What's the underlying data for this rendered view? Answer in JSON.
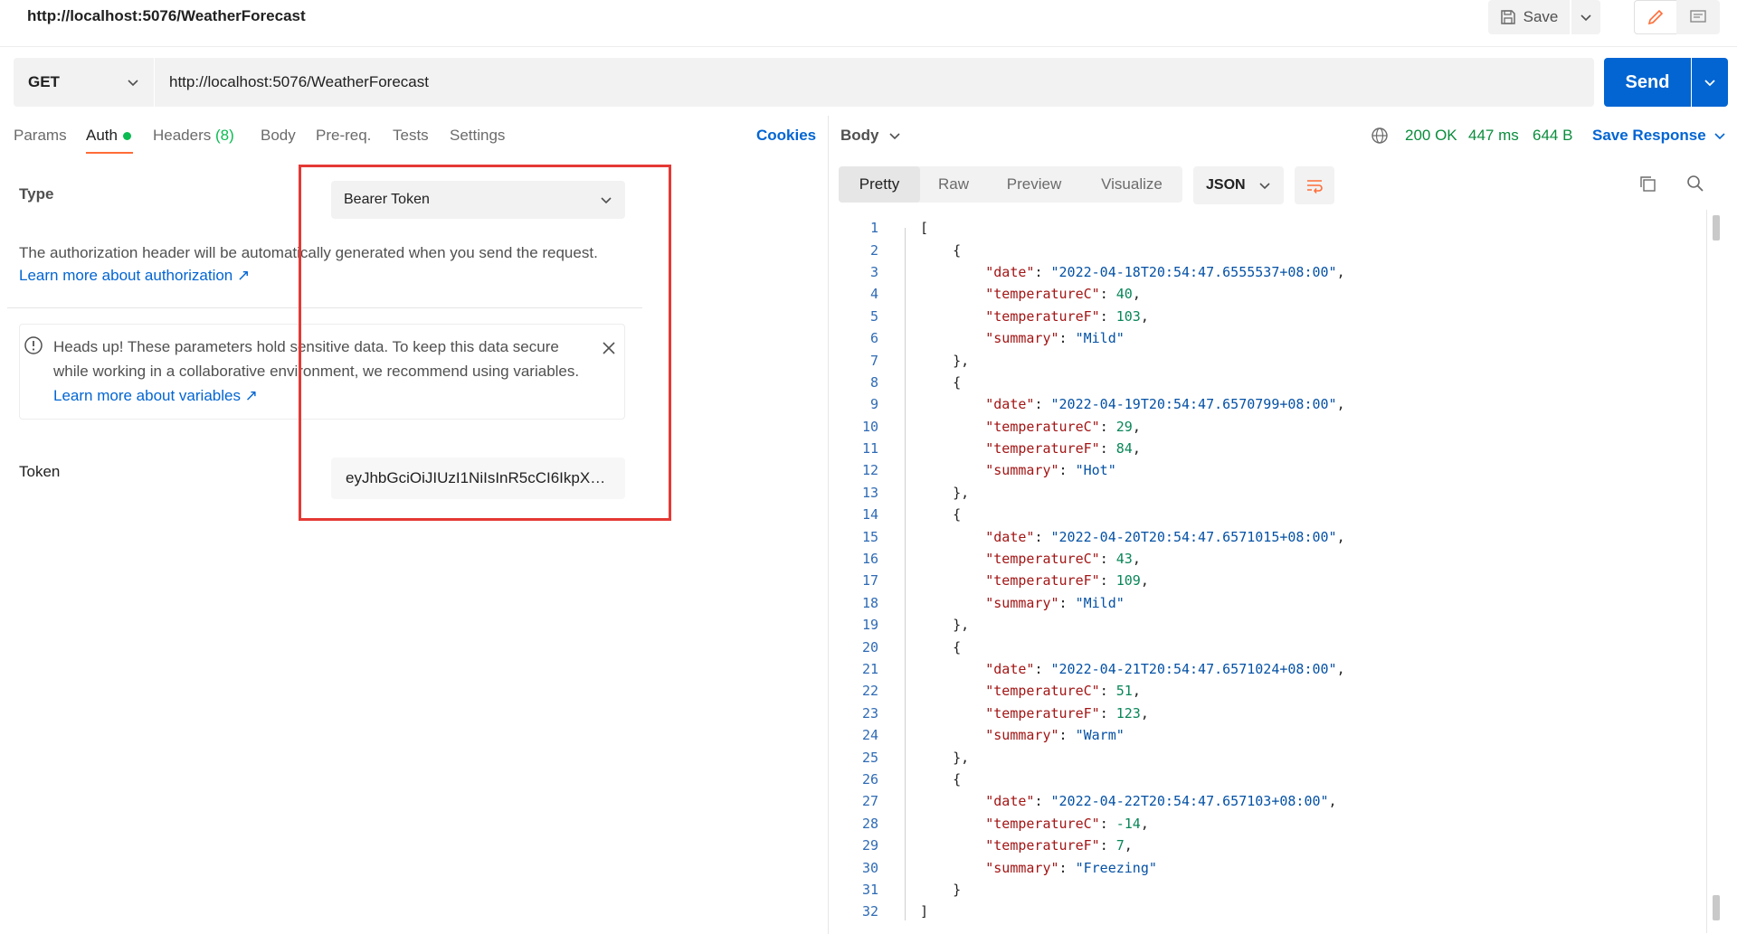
{
  "header": {
    "url_title": "http://localhost:5076/WeatherForecast",
    "save_label": "Save"
  },
  "request": {
    "method": "GET",
    "url": "http://localhost:5076/WeatherForecast",
    "send_label": "Send"
  },
  "tabs": {
    "params": "Params",
    "auth": "Auth",
    "headers": "Headers",
    "headers_count": "(8)",
    "body": "Body",
    "prereq": "Pre-req.",
    "tests": "Tests",
    "settings": "Settings",
    "cookies": "Cookies"
  },
  "auth": {
    "type_label": "Type",
    "type_value": "Bearer Token",
    "description": "The authorization header will be automatically generated when you send the request.",
    "learn_more": "Learn more about authorization ↗",
    "warning_text": "Heads up! These parameters hold sensitive data. To keep this data secure while working in a collaborative environment, we recommend using variables.",
    "warning_link": "Learn more about variables ↗",
    "token_label": "Token",
    "token_value": "eyJhbGciOiJIUzI1NiIsInR5cCI6IkpXVCJ9..."
  },
  "response": {
    "body_label": "Body",
    "status": "200 OK",
    "time": "447 ms",
    "size": "644 B",
    "save_response": "Save Response",
    "views": [
      "Pretty",
      "Raw",
      "Preview",
      "Visualize"
    ],
    "format": "JSON"
  },
  "json_items": [
    {
      "date": "2022-04-18T20:54:47.6555537+08:00",
      "temperatureC": 40,
      "temperatureF": 103,
      "summary": "Mild"
    },
    {
      "date": "2022-04-19T20:54:47.6570799+08:00",
      "temperatureC": 29,
      "temperatureF": 84,
      "summary": "Hot"
    },
    {
      "date": "2022-04-20T20:54:47.6571015+08:00",
      "temperatureC": 43,
      "temperatureF": 109,
      "summary": "Mild"
    },
    {
      "date": "2022-04-21T20:54:47.6571024+08:00",
      "temperatureC": 51,
      "temperatureF": 123,
      "summary": "Warm"
    },
    {
      "date": "2022-04-22T20:54:47.657103+08:00",
      "temperatureC": -14,
      "temperatureF": 7,
      "summary": "Freezing"
    }
  ],
  "icon_names": [
    "save-icon",
    "pencil-icon",
    "comment-icon",
    "chevron-down-icon",
    "globe-icon",
    "info-icon",
    "close-icon",
    "wrap-icon",
    "copy-icon",
    "search-icon"
  ]
}
